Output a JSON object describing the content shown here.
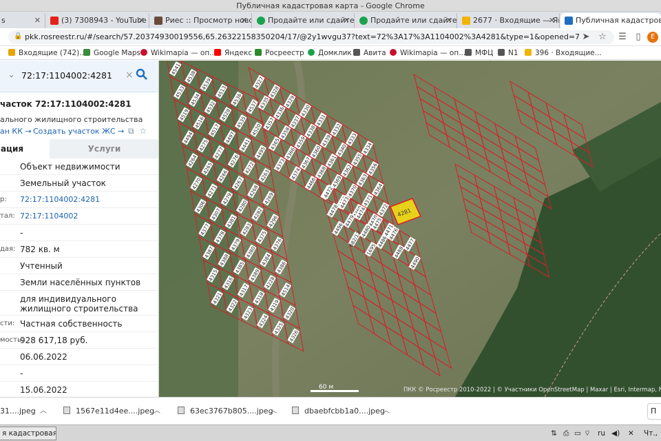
{
  "window": {
    "title": "Публичная кадастровая карта - Google Chrome"
  },
  "tabs": [
    {
      "label": "s",
      "color": "#888888"
    },
    {
      "label": "(3) 7308943 - YouTube",
      "color": "#e62117"
    },
    {
      "label": "Риес :: Просмотр новос",
      "color": "#6b4a3a"
    },
    {
      "label": "Продайте или сдайте в",
      "color": "#1aa34a"
    },
    {
      "label": "Продайте или сдайте в",
      "color": "#1aa34a"
    },
    {
      "label": "2677 · Входящие — Ян",
      "color": "#f2b400"
    },
    {
      "label": "Публичная кадастровая",
      "color": "#1f6fbf"
    }
  ],
  "address": {
    "url": "pkk.rosreestr.ru/#/search/57.20374930019556,65.26322158350204/17/@2y1wvgu37?text=72%3A17%3A1104002%3A4281&type=1&opened=72%3A17%3..."
  },
  "bookmarks": [
    {
      "label": "Входящие (742)...",
      "color": "#e8a400"
    },
    {
      "label": "Google Maps",
      "color": "#3a8c3a"
    },
    {
      "label": "Wikimapia — оп...",
      "color": "#c8102e"
    },
    {
      "label": "Яндекс",
      "color": "#ff0000"
    },
    {
      "label": "Росреестр",
      "color": "#2a8a2a"
    },
    {
      "label": "Домклик",
      "color": "#1aa34a"
    },
    {
      "label": "Авита",
      "color": "#555555"
    },
    {
      "label": "Wikimapia — оп...",
      "color": "#c8102e"
    },
    {
      "label": "МФЦ",
      "color": "#555555"
    },
    {
      "label": "N1",
      "color": "#555555"
    },
    {
      "label": "396 · Входящие...",
      "color": "#f2b400"
    }
  ],
  "panel": {
    "search_value": "72:17:1104002:4281",
    "title": "часток 72:17:1104002:4281",
    "subtitle": "ального жилищного строительства",
    "link_left": "ан КК",
    "link_right": "Создать участок ЖС",
    "tab_info": "ация",
    "tab_services": "Услуги",
    "rows": [
      {
        "label": "",
        "value": "Объект недвижимости",
        "link": false
      },
      {
        "label": "",
        "value": "Земельный участок",
        "link": false
      },
      {
        "label": "р:",
        "value": "72:17:1104002:4281",
        "link": true
      },
      {
        "label": "тал:",
        "value": "72:17:1104002",
        "link": true
      },
      {
        "label": "",
        "value": "-",
        "link": false
      },
      {
        "label": "дая:",
        "value": "782 кв. м",
        "link": false
      },
      {
        "label": "",
        "value": "Учтенный",
        "link": false
      },
      {
        "label": "",
        "value": "Земли населённых пунктов",
        "link": false
      },
      {
        "label": "",
        "value": "для индивидуального жилищного строительства",
        "link": false
      },
      {
        "label": "сти:",
        "value": "Частная собственность",
        "link": false
      },
      {
        "label": "мость:",
        "value": "928 617,18 руб.",
        "link": false
      },
      {
        "label": "",
        "value": "06.06.2022",
        "link": false
      },
      {
        "label": "",
        "value": "-",
        "link": false
      },
      {
        "label": "",
        "value": "15.06.2022",
        "link": false
      }
    ]
  },
  "map": {
    "scale_label": "60 м",
    "attribution": "ПКК © Росреестр 2010-2022 | © Участники OpenStreetMap | Maxar | Esri, Intermap, NASA, NGA",
    "highlight_label": "4281",
    "parcel_labels": [
      "4541",
      "4538",
      "4539",
      "4513",
      "4536",
      "4537",
      "4533",
      "4534",
      "4532",
      "4528",
      "4535",
      "4520",
      "4519",
      "4516",
      "4517",
      "4497",
      "4441",
      "4495",
      "4494",
      "4275",
      "4277",
      "4276",
      "4272",
      "4263",
      "4264",
      "4265",
      "4266",
      "4267",
      "4268",
      "4269",
      "4270",
      "4271",
      "4279",
      "4280",
      "4282",
      "4296",
      "4306",
      "4307",
      "4381",
      "4283",
      "4375",
      "4376",
      "4377",
      "4378",
      "4379",
      "4380",
      "4384",
      "4386",
      "4387",
      "4388",
      "4385",
      "4389",
      "4228",
      "4514",
      "4315",
      "4316",
      "4317",
      "4318",
      "4319",
      "4320",
      "4321",
      "4322",
      "4323",
      "4324",
      "4325",
      "4326",
      "4327",
      "4328",
      "4329",
      "4330",
      "4331",
      "4332",
      "4333",
      "4334",
      "4335",
      "4336",
      "4337",
      "4338",
      "4339",
      "4340",
      "4355",
      "4356",
      "4357",
      "4358",
      "4359",
      "4360",
      "4361",
      "4362",
      "4363",
      "4364",
      "4365",
      "4366",
      "4367",
      "4368",
      "4369",
      "4370",
      "4371",
      "4372",
      "4373",
      "4374",
      "4466",
      "4467",
      "4468",
      "4469",
      "4470",
      "4471",
      "4472",
      "4473",
      "4474",
      "4475",
      "4476",
      "4477",
      "4478",
      "4479",
      "4480",
      "4486",
      "4488",
      "4490",
      "4496",
      "682/12",
      "1695"
    ]
  },
  "downloads": [
    {
      "label": "31....jpeg"
    },
    {
      "label": "1567e11d4ee....jpeg"
    },
    {
      "label": "63ec3767b805....jpeg"
    },
    {
      "label": "dbaebfcbb1a0....jpeg"
    }
  ],
  "downloads_showall": "П",
  "taskbar": {
    "button": "я кадастровая ...",
    "lang": "ru",
    "clock": "Чт., 1"
  },
  "colors": {
    "accent": "#1f6fbf",
    "parcel_line": "#d61f2a",
    "highlight": "#e6d21a"
  }
}
